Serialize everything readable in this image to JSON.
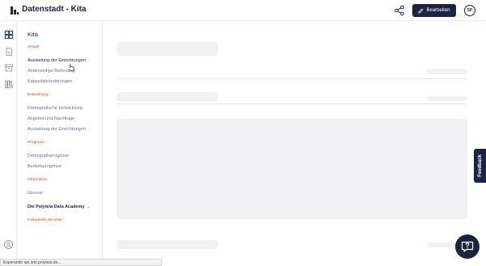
{
  "header": {
    "title": "Datenstadt - Kita",
    "edit_label": "Bearbeiten",
    "avatar_initials": "SP",
    "logo_icon": "bars-logo-icon",
    "share_icon": "share-icon",
    "edit_icon": "pencil-icon"
  },
  "rail": {
    "items": [
      {
        "icon": "dashboard-icon",
        "active": true
      },
      {
        "icon": "document-icon",
        "active": false
      },
      {
        "icon": "archive-icon",
        "active": false
      },
      {
        "icon": "library-icon",
        "active": false
      }
    ],
    "bottom_icon": "user-circle-icon"
  },
  "sidebar": {
    "title": "Kita",
    "sections": {
      "aktuell": "Aktuell",
      "entwicklung": "Entwicklung",
      "prognose": "Prognose",
      "information": "Information",
      "individuelle": "Individuelle Berichte"
    },
    "items": {
      "auslastung": "Auslastung der Einrichtungen",
      "anderweitige": "Anderweitige Betreuung",
      "kapazitaet": "Kapazitätsänderungen",
      "demografische": "Demografische Entwicklung",
      "angebot": "Angebot und Nachfrage",
      "auslastung2": "Auslastung der Einrichtungen",
      "demografieprognose": "Demografieprognose",
      "bedarfsprognose": "Bedarfsprognose",
      "glossar": "Glossar",
      "academy": "Die Polyteia Data Academy →"
    }
  },
  "feedback_label": "Feedback",
  "help_icon": "question-icon",
  "status_bar": "Esperando api.leto.polyteia.de...",
  "colors": {
    "navy": "#1b2340",
    "section_orange": "#d9451f",
    "skeleton": "#f1f1f3"
  }
}
